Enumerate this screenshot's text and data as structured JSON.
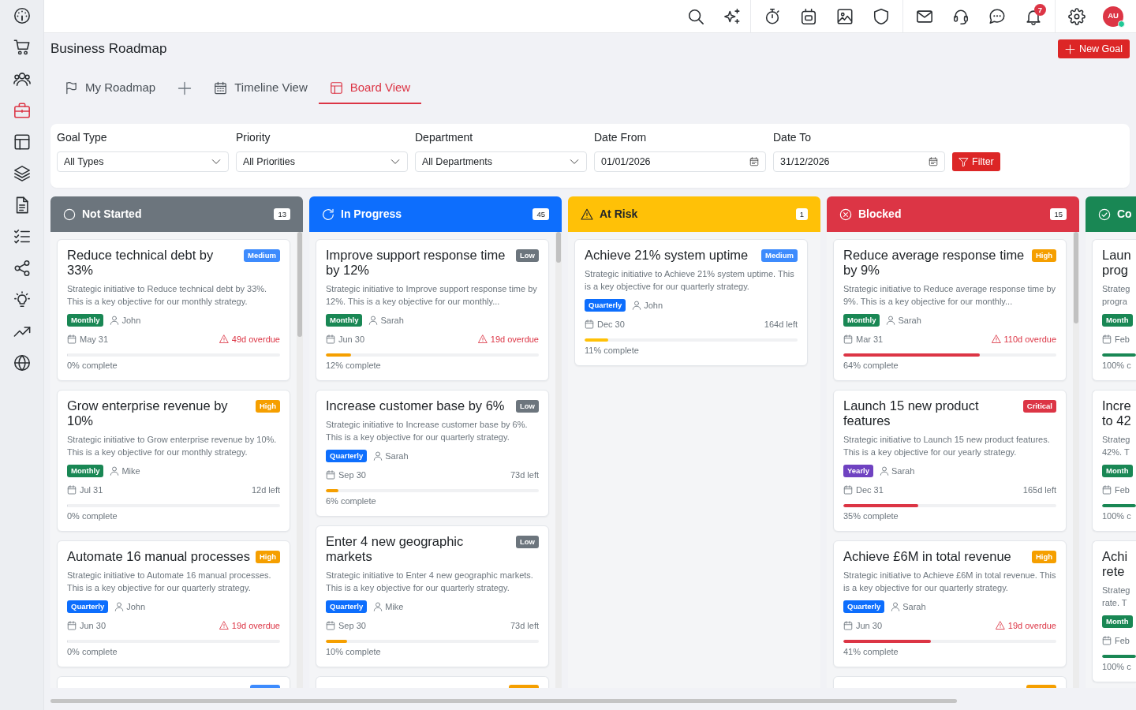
{
  "sidebar": {
    "items": [
      {
        "selected": false
      },
      {
        "selected": false
      },
      {
        "selected": false
      },
      {
        "selected": true
      },
      {
        "selected": false
      },
      {
        "selected": false
      },
      {
        "selected": false
      },
      {
        "selected": false
      },
      {
        "selected": false
      },
      {
        "selected": false
      },
      {
        "selected": false
      },
      {
        "selected": false
      }
    ]
  },
  "topbar": {
    "notification_count": "7",
    "avatar": {
      "initials": "AU",
      "online": true
    }
  },
  "page": {
    "title": "Business Roadmap",
    "new_button": "New Goal"
  },
  "tabs": [
    {
      "kind": "tab",
      "label": "My Roadmap",
      "selected": false
    },
    {
      "kind": "add"
    },
    {
      "kind": "tab",
      "label": "Timeline View",
      "selected": false
    },
    {
      "kind": "tab",
      "label": "Board View",
      "selected": true
    }
  ],
  "filters": {
    "fields": [
      {
        "kind": "select",
        "label": "Goal Type",
        "value": "All Types"
      },
      {
        "kind": "select",
        "label": "Priority",
        "value": "All Priorities"
      },
      {
        "kind": "select",
        "label": "Department",
        "value": "All Departments"
      },
      {
        "kind": "date",
        "label": "Date From",
        "value": "01/01/2026"
      },
      {
        "kind": "date",
        "label": "Date To",
        "value": "31/12/2026"
      }
    ],
    "button": "Filter"
  },
  "board": {
    "columns": [
      {
        "kind": "not-started",
        "title": "Not Started",
        "count": "13",
        "color": "#6c757d",
        "cards": [
          {
            "title": "Reduce technical debt by 33%",
            "priority": {
              "label": "Medium",
              "color": "#3d8bfd"
            },
            "description": "Strategic initiative to Reduce technical debt by 33%. This is a key objective for our monthly strategy.",
            "period": {
              "label": "Monthly",
              "color": "#198754"
            },
            "owner": "John",
            "date": "May 31",
            "due": "49d overdue",
            "overdue": true,
            "level": 0,
            "progress": "0% complete"
          },
          {
            "title": "Grow enterprise revenue by 10%",
            "priority": {
              "label": "High",
              "color": "#f59f00"
            },
            "description": "Strategic initiative to Grow enterprise revenue by 10%. This is a key objective for our monthly strategy.",
            "period": {
              "label": "Monthly",
              "color": "#198754"
            },
            "owner": "Mike",
            "date": "Jul 31",
            "due": "12d left",
            "overdue": false,
            "level": 0,
            "progress": "0% complete"
          },
          {
            "title": "Automate 16 manual processes",
            "priority": {
              "label": "High",
              "color": "#f59f00"
            },
            "description": "Strategic initiative to Automate 16 manual processes. This is a key objective for our quarterly strategy.",
            "period": {
              "label": "Quarterly",
              "color": "#0d6efd"
            },
            "owner": "John",
            "date": "Jun 30",
            "due": "19d overdue",
            "overdue": true,
            "level": 0,
            "progress": "0% complete"
          },
          {
            "kind": "partial",
            "color": "#3d8bfd"
          }
        ]
      },
      {
        "kind": "in-progress",
        "title": "In Progress",
        "count": "45",
        "color": "#0d6efd",
        "bar": {
          "color": "#f59f00"
        },
        "cards": [
          {
            "title": "Improve support response time by 12%",
            "priority": {
              "label": "Low",
              "color": "#6c757d"
            },
            "description": "Strategic initiative to Improve support response time by 12%. This is a key objective for our monthly...",
            "period": {
              "label": "Monthly",
              "color": "#198754"
            },
            "owner": "Sarah",
            "date": "Jun 30",
            "due": "19d overdue",
            "overdue": true,
            "level": 0.12,
            "progress": "12% complete"
          },
          {
            "title": "Increase customer base by 6%",
            "priority": {
              "label": "Low",
              "color": "#6c757d"
            },
            "description": "Strategic initiative to Increase customer base by 6%. This is a key objective for our quarterly strategy.",
            "period": {
              "label": "Quarterly",
              "color": "#0d6efd"
            },
            "owner": "Sarah",
            "date": "Sep 30",
            "due": "73d left",
            "overdue": false,
            "level": 0.06,
            "progress": "6% complete"
          },
          {
            "title": "Enter 4 new geographic markets",
            "priority": {
              "label": "Low",
              "color": "#6c757d"
            },
            "description": "Strategic initiative to Enter 4 new geographic markets. This is a key objective for our quarterly strategy.",
            "period": {
              "label": "Quarterly",
              "color": "#0d6efd"
            },
            "owner": "Mike",
            "date": "Sep 30",
            "due": "73d left",
            "overdue": false,
            "level": 0.1,
            "progress": "10% complete"
          },
          {
            "kind": "partial",
            "color": "#f59f00"
          }
        ]
      },
      {
        "kind": "at-risk",
        "title": "At Risk",
        "count": "1",
        "color": "#ffc107",
        "bar": {
          "color": "#ffc107"
        },
        "cards": [
          {
            "title": "Achieve 21% system uptime",
            "priority": {
              "label": "Medium",
              "color": "#3d8bfd"
            },
            "description": "Strategic initiative to Achieve 21% system uptime. This is a key objective for our quarterly strategy.",
            "period": {
              "label": "Quarterly",
              "color": "#0d6efd"
            },
            "owner": "John",
            "date": "Dec 30",
            "due": "164d left",
            "overdue": false,
            "level": 0.11,
            "progress": "11% complete"
          }
        ]
      },
      {
        "kind": "blocked",
        "title": "Blocked",
        "count": "15",
        "color": "#dc3545",
        "bar": {
          "color": "#dc3545"
        },
        "cards": [
          {
            "title": "Reduce average response time by 9%",
            "priority": {
              "label": "High",
              "color": "#f59f00"
            },
            "description": "Strategic initiative to Reduce average response time by 9%. This is a key objective for our monthly...",
            "period": {
              "label": "Monthly",
              "color": "#198754"
            },
            "owner": "Sarah",
            "date": "Mar 31",
            "due": "110d overdue",
            "overdue": true,
            "level": 0.64,
            "progress": "64% complete"
          },
          {
            "title": "Launch 15 new product features",
            "priority": {
              "label": "Critical",
              "color": "#dc3545"
            },
            "description": "Strategic initiative to Launch 15 new product features. This is a key objective for our yearly strategy.",
            "period": {
              "label": "Yearly",
              "color": "#6f42c1"
            },
            "owner": "Sarah",
            "date": "Dec 31",
            "due": "165d left",
            "overdue": false,
            "level": 0.35,
            "progress": "35% complete"
          },
          {
            "title": "Achieve £6M in total revenue",
            "priority": {
              "label": "High",
              "color": "#f59f00"
            },
            "description": "Strategic initiative to Achieve £6M in total revenue. This is a key objective for our quarterly strategy.",
            "period": {
              "label": "Quarterly",
              "color": "#0d6efd"
            },
            "owner": "Sarah",
            "date": "Jun 30",
            "due": "19d overdue",
            "overdue": true,
            "level": 0.41,
            "progress": "41% complete"
          },
          {
            "kind": "partial",
            "color": "#f59f00"
          }
        ]
      },
      {
        "kind": "completed",
        "title": "Co",
        "color": "#198754",
        "bar": {
          "color": "#198754"
        },
        "cards": [
          {
            "title": "Laun prog",
            "description": "Strateg progra",
            "period": {
              "label": "Month",
              "color": "#198754"
            },
            "date": "Feb",
            "level": 1,
            "progress": "100% c"
          },
          {
            "title": "Incre to 42",
            "description": "Strateg 42%. T",
            "period": {
              "label": "Month",
              "color": "#198754"
            },
            "date": "Feb",
            "level": 1,
            "progress": "100% c"
          },
          {
            "title": "Achi rete",
            "description": "Strateg rate. T",
            "period": {
              "label": "Month",
              "color": "#198754"
            },
            "date": "Feb",
            "level": 1,
            "progress": "100% c"
          }
        ]
      }
    ]
  }
}
